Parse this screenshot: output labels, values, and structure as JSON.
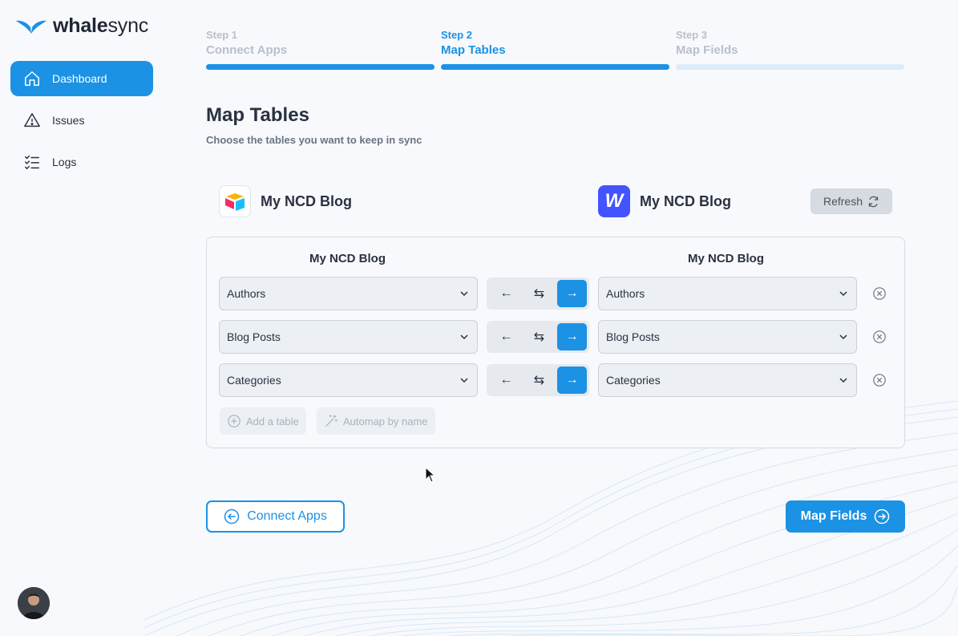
{
  "brand": {
    "part1": "whale",
    "part2": "sync",
    "color": "#1b92e4"
  },
  "nav": [
    {
      "label": "Dashboard",
      "icon": "home-icon",
      "active": true
    },
    {
      "label": "Issues",
      "icon": "warning-icon",
      "active": false
    },
    {
      "label": "Logs",
      "icon": "checklist-icon",
      "active": false
    }
  ],
  "steps": [
    {
      "num": "Step 1",
      "label": "Connect Apps",
      "state": "done"
    },
    {
      "num": "Step 2",
      "label": "Map Tables",
      "state": "active"
    },
    {
      "num": "Step 3",
      "label": "Map Fields",
      "state": "pending"
    }
  ],
  "page": {
    "title": "Map Tables",
    "subtitle": "Choose the tables you want to keep in sync"
  },
  "source": {
    "name": "My NCD Blog",
    "icon": "airtable-icon"
  },
  "destination": {
    "name": "My NCD Blog",
    "icon": "webflow-icon",
    "icon_glyph": "W"
  },
  "refresh_label": "Refresh",
  "mapping": {
    "left_header": "My NCD Blog",
    "right_header": "My NCD Blog",
    "rows": [
      {
        "left": "Authors",
        "right": "Authors",
        "direction": "right"
      },
      {
        "left": "Blog Posts",
        "right": "Blog Posts",
        "direction": "right"
      },
      {
        "left": "Categories",
        "right": "Categories",
        "direction": "right"
      }
    ],
    "add_table_label": "Add a table",
    "automap_label": "Automap by name"
  },
  "footer": {
    "back_label": "Connect Apps",
    "next_label": "Map Fields"
  }
}
